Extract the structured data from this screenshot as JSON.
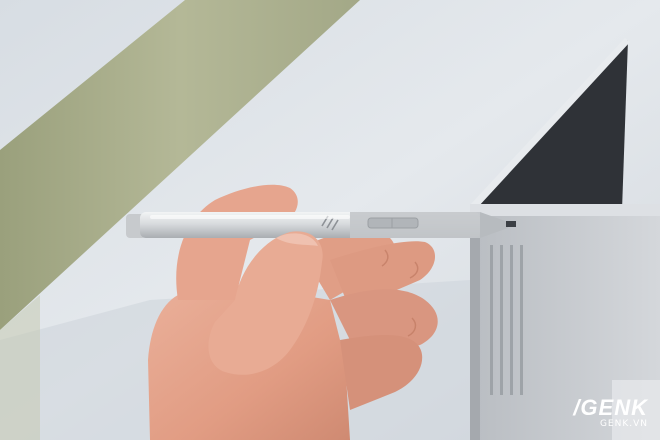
{
  "photo": {
    "subject": "hand-holding-stylus-pen",
    "palette": {
      "wall": "#e3e7ec",
      "olive_band": "#aeb38f",
      "laptop_dark": "#2e3136",
      "laptop_silver": "#c8ccd1",
      "pen_silver": "#d9dcdf",
      "skin": "#e6a089"
    }
  },
  "watermark": {
    "brand": "/GENK",
    "domain": "GENK.VN"
  }
}
